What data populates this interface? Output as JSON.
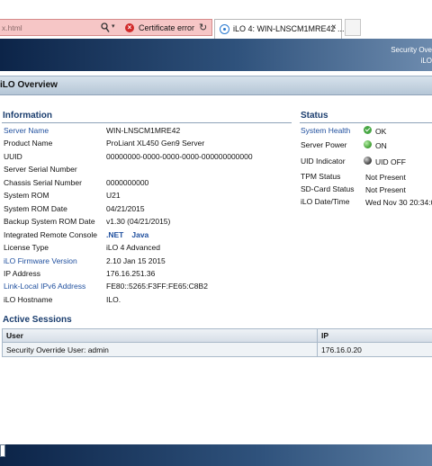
{
  "browser": {
    "address_text": "x.html",
    "cert_error_label": "Certificate error",
    "tab_title": "iLO 4: WIN-LNSCM1MRE42 ...",
    "address_bg_color": "#f6c6c6"
  },
  "header": {
    "right_line1": "Security Ove",
    "right_line2": "iLO",
    "page_title": "iLO Overview"
  },
  "information": {
    "heading": "Information",
    "rows": [
      {
        "label": "Server Name",
        "value": "WIN-LNSCM1MRE42",
        "link": true
      },
      {
        "label": "Product Name",
        "value": "ProLiant XL450 Gen9 Server",
        "link": false
      },
      {
        "label": "UUID",
        "value": "00000000-0000-0000-0000-000000000000",
        "link": false
      },
      {
        "label": "Server Serial Number",
        "value": "",
        "link": false
      },
      {
        "label": "Chassis Serial Number",
        "value": "0000000000",
        "link": false
      },
      {
        "label": "System ROM",
        "value": "U21",
        "link": false
      },
      {
        "label": "System ROM Date",
        "value": "04/21/2015",
        "link": false
      },
      {
        "label": "Backup System ROM Date",
        "value": "v1.30 (04/21/2015)",
        "link": false
      },
      {
        "label": "Integrated Remote Console",
        "value": "",
        "link": false
      },
      {
        "label": "License Type",
        "value": "iLO 4 Advanced",
        "link": false
      },
      {
        "label": "iLO Firmware Version",
        "value": "2.10 Jan 15 2015",
        "link": true
      },
      {
        "label": "IP Address",
        "value": "176.16.251.36",
        "link": false
      },
      {
        "label": "Link-Local IPv6 Address",
        "value": "FE80::5265:F3FF:FE65:C8B2",
        "link": true
      },
      {
        "label": "iLO Hostname",
        "value": "ILO.",
        "link": false
      }
    ],
    "remote_console": {
      "net": ".NET",
      "java": "Java"
    }
  },
  "status": {
    "heading": "Status",
    "rows": [
      {
        "label": "System Health",
        "value": "OK",
        "icon": "check-icon",
        "link": true
      },
      {
        "label": "Server Power",
        "value": "ON",
        "icon": "green-led-icon",
        "link": false
      },
      {
        "label": "UID Indicator",
        "value": "UID OFF",
        "icon": "grey-led-icon",
        "link": false
      },
      {
        "label": "TPM Status",
        "value": "Not Present",
        "icon": "",
        "link": false
      },
      {
        "label": "SD-Card Status",
        "value": "Not Present",
        "icon": "",
        "link": false
      },
      {
        "label": "iLO Date/Time",
        "value": "Wed Nov 30 20:34:0",
        "icon": "",
        "link": false
      }
    ]
  },
  "sessions": {
    "heading": "Active Sessions",
    "columns": [
      "User",
      "IP"
    ],
    "rows": [
      {
        "user": "Security Override User: admin",
        "ip": "176.16.0.20"
      }
    ]
  },
  "colors": {
    "banner_dark": "#0c2448",
    "link_blue": "#1f4f9e",
    "heading_blue": "#1a3d6e"
  }
}
